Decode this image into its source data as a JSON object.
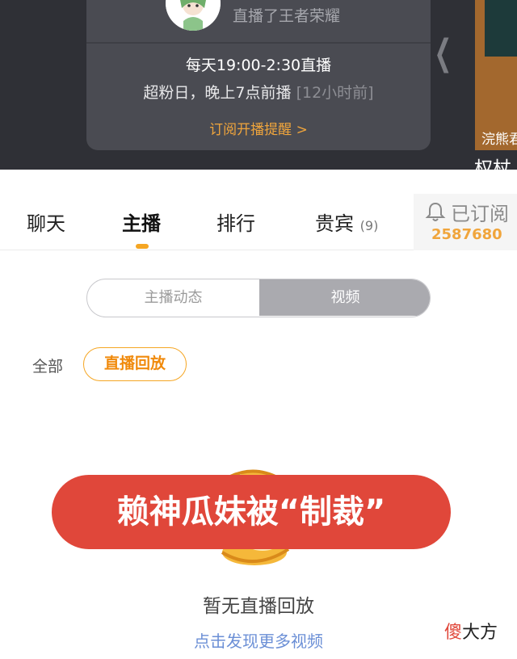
{
  "header": {
    "streamed_game_text": "直播了王者荣耀",
    "schedule_time": "每天19:00-2:30直播",
    "schedule_note": "超粉日，晚上7点前播",
    "schedule_note_muted": "[12小时前]",
    "subscribe_reminder": "订阅开播提醒 >",
    "side_thumb_label": "浣熊君",
    "side_title": "权杖"
  },
  "tabs": [
    {
      "label": "聊天"
    },
    {
      "label": "主播"
    },
    {
      "label": "排行"
    },
    {
      "label": "贵宾",
      "count": "(9)"
    }
  ],
  "subscribed": {
    "label": "已订阅",
    "count": "2587680"
  },
  "segment": {
    "left_label": "主播动态",
    "right_label": "视频"
  },
  "filters": {
    "all_label": "全部",
    "replay_label": "直播回放"
  },
  "banner": {
    "text": "赖神瓜妹被“制裁”"
  },
  "empty_state": {
    "message": "暂无直播回放",
    "link": "点击发现更多视频"
  },
  "watermark": {
    "accent": "傻",
    "text": "大方"
  },
  "colors": {
    "accent_orange": "#f5a623",
    "banner_red": "#e0473a",
    "link_blue": "#6b8fd6"
  }
}
